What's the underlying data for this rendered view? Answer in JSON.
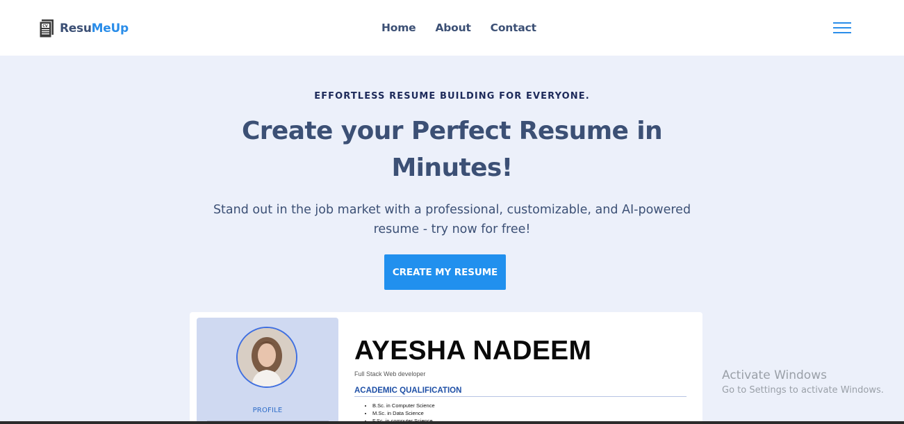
{
  "brand": {
    "name_part1": "Resu",
    "name_part2": "MeUp",
    "logo_icon": "cv-document-icon"
  },
  "nav": {
    "links": [
      {
        "label": "Home"
      },
      {
        "label": "About"
      },
      {
        "label": "Contact"
      }
    ],
    "menu_icon": "hamburger-menu-icon"
  },
  "hero": {
    "eyebrow": "EFFORTLESS RESUME BUILDING FOR EVERYONE.",
    "headline": "Create your Perfect Resume in Minutes!",
    "subtitle": "Stand out in the job market with a professional, customizable, and AI-powered resume - try now for free!",
    "cta_label": "CREATE MY RESUME"
  },
  "resume_preview": {
    "name": "AYESHA NADEEM",
    "role": "Full Stack Web developer",
    "profile_label": "PROFILE",
    "section_title": "ACADEMIC QUALIFICATION",
    "qualifications": [
      "B.Sc. in Computer Science",
      "M.Sc. in Data Science",
      "F.Sc. in computer Science"
    ]
  },
  "watermark": {
    "title": "Activate Windows",
    "subtitle": "Go to Settings to activate Windows."
  },
  "colors": {
    "accent": "#2190ee",
    "heading": "#3c5075",
    "background": "#ecf0fa"
  }
}
